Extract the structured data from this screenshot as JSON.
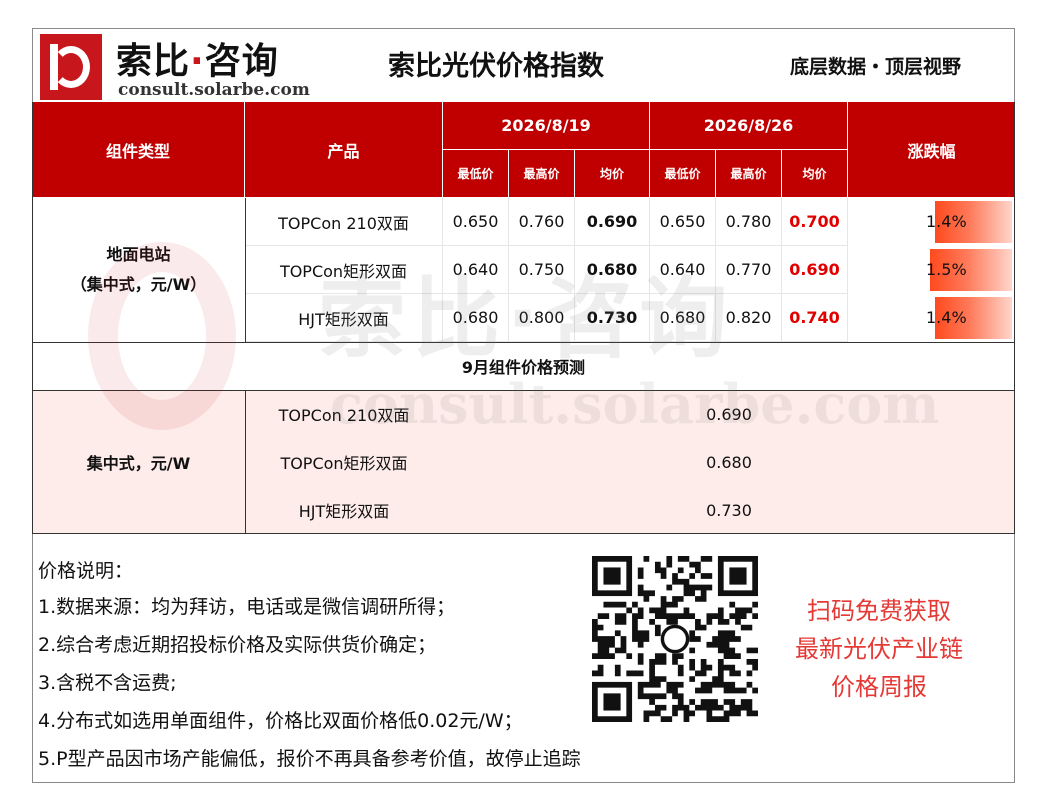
{
  "header": {
    "brand_name_a": "索比",
    "brand_dot": "·",
    "brand_name_b": "咨询",
    "brand_url": "consult.solarbe.com",
    "title": "索比光伏价格指数",
    "slogan": "底层数据・顶层视野"
  },
  "table": {
    "col_type": "组件类型",
    "col_product": "产品",
    "date1": "2026/8/19",
    "date2": "2026/8/26",
    "col_change": "涨跌幅",
    "sub_low": "最低价",
    "sub_high": "最高价",
    "sub_avg": "均价",
    "group_label": "地面电站\n（集中式，元/W）",
    "rows": [
      {
        "product": "TOPCon 210双面",
        "low1": "0.650",
        "high1": "0.760",
        "avg1": "0.690",
        "low2": "0.650",
        "high2": "0.780",
        "avg2": "0.700",
        "change": "1.4%",
        "change_value": 1.4
      },
      {
        "product": "TOPCon矩形双面",
        "low1": "0.640",
        "high1": "0.750",
        "avg1": "0.680",
        "low2": "0.640",
        "high2": "0.770",
        "avg2": "0.690",
        "change": "1.5%",
        "change_value": 1.5
      },
      {
        "product": "HJT矩形双面",
        "low1": "0.680",
        "high1": "0.800",
        "avg1": "0.730",
        "low2": "0.680",
        "high2": "0.820",
        "avg2": "0.740",
        "change": "1.4%",
        "change_value": 1.4
      }
    ],
    "forecast_title": "9月组件价格预测",
    "forecast_group": "集中式，元/W",
    "forecast_rows": [
      {
        "product": "TOPCon 210双面",
        "value": "0.690"
      },
      {
        "product": "TOPCon矩形双面",
        "value": "0.680"
      },
      {
        "product": "HJT矩形双面",
        "value": "0.730"
      }
    ]
  },
  "notes": {
    "title": "价格说明：",
    "items": [
      "1.数据来源：均为拜访，电话或是微信调研所得；",
      "2.综合考虑近期招投标价格及实际供货价确定；",
      "3.含税不含运费;",
      "4.分布式如选用单面组件，价格比双面价格低0.02元/W；",
      "5.P型产品因市场产能偏低，报价不再具备参考价值，故停止追踪"
    ]
  },
  "promo": {
    "line1": "扫码免费获取",
    "line2": "最新光伏产业链",
    "line3": "价格周报"
  },
  "watermark": {
    "text": "索比·咨询",
    "url": "consult.solarbe.com"
  },
  "colors": {
    "header_red": "#c00000",
    "brand_red": "#c8161d",
    "price_red": "#e00000",
    "forecast_bg": "#fdecea",
    "promo_red": "#e53935"
  },
  "icons": [
    "brand-logo-icon",
    "qr-code-icon"
  ]
}
